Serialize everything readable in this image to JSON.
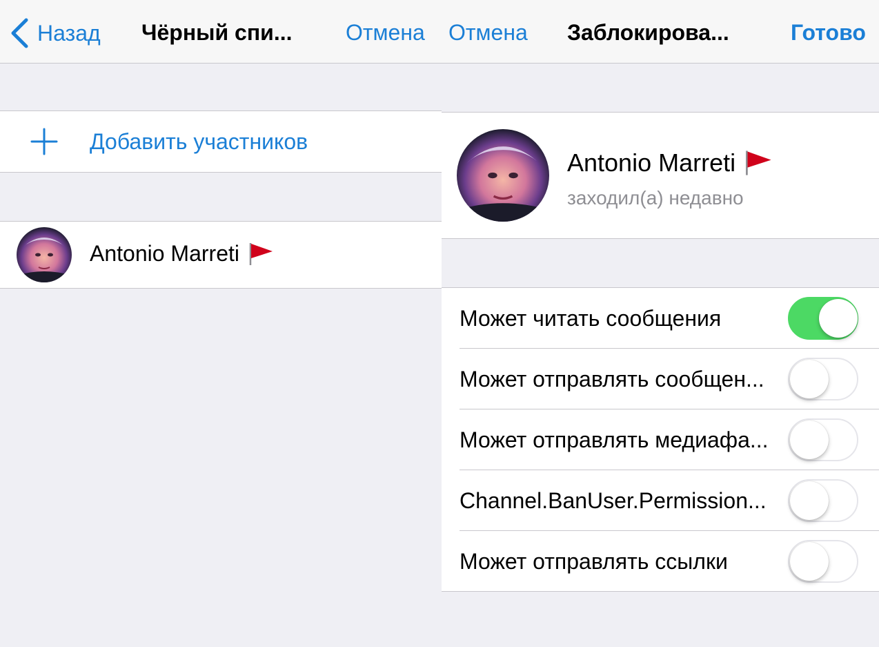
{
  "left": {
    "nav": {
      "back_label": "Назад",
      "title": "Чёрный спи...",
      "cancel_label": "Отмена"
    },
    "add_members_label": "Добавить участников",
    "member": {
      "first_name": "Antonio",
      "last_name": "Marreti",
      "flag_icon": "red-flag-icon"
    }
  },
  "right": {
    "nav": {
      "cancel_label": "Отмена",
      "title": "Заблокирова...",
      "done_label": "Готово"
    },
    "profile": {
      "name": "Antonio Marreti",
      "status": "заходил(а) недавно",
      "flag_icon": "red-flag-icon"
    },
    "permissions": [
      {
        "label": "Может читать сообщения",
        "on": true
      },
      {
        "label": "Может отправлять сообщен...",
        "on": false
      },
      {
        "label": "Может отправлять медиафа...",
        "on": false
      },
      {
        "label": "Channel.BanUser.Permission...",
        "on": false
      },
      {
        "label": "Может отправлять ссылки",
        "on": false
      }
    ]
  },
  "colors": {
    "accent": "#1b7fd6",
    "toggle_on": "#4cd964",
    "background": "#efeff4"
  }
}
